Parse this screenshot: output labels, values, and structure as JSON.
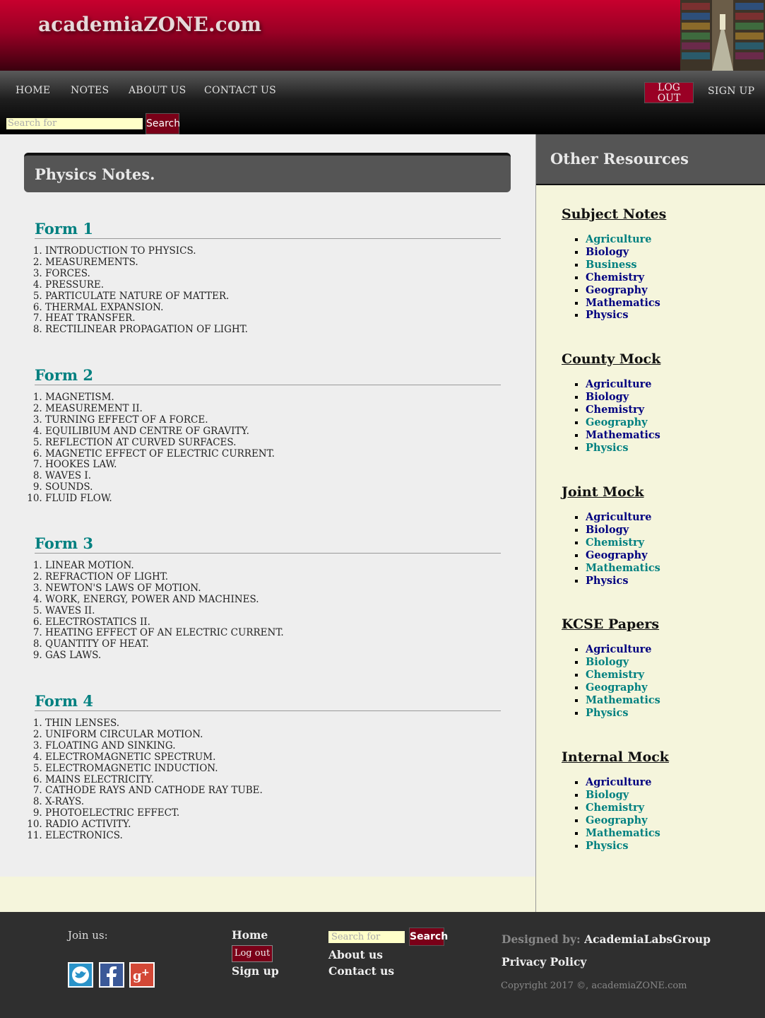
{
  "site": {
    "logo": "academiaZONE.com"
  },
  "nav": {
    "items": [
      "HOME",
      "NOTES",
      "ABOUT US",
      "CONTACT US"
    ],
    "logout": "LOG OUT",
    "signup": "SIGN UP",
    "search_placeholder": "Search for",
    "search_button": "Search"
  },
  "main": {
    "title": "Physics Notes.",
    "forms": [
      {
        "heading": "Form 1",
        "topics": [
          "INTRODUCTION TO PHYSICS.",
          "MEASUREMENTS.",
          "FORCES.",
          "PRESSURE.",
          "PARTICULATE NATURE OF MATTER.",
          "THERMAL EXPANSION.",
          "HEAT TRANSFER.",
          "RECTILINEAR PROPAGATION OF LIGHT."
        ]
      },
      {
        "heading": "Form 2",
        "topics": [
          "MAGNETISM.",
          "MEASUREMENT II.",
          "TURNING EFFECT OF A FORCE.",
          "EQUILIBIUM AND CENTRE OF GRAVITY.",
          "REFLECTION AT CURVED SURFACES.",
          "MAGNETIC EFFECT OF ELECTRIC CURRENT.",
          "HOOKES LAW.",
          "WAVES I.",
          "SOUNDS.",
          "FLUID FLOW."
        ]
      },
      {
        "heading": "Form 3",
        "topics": [
          "LINEAR MOTION.",
          "REFRACTION OF LIGHT.",
          "NEWTON'S LAWS OF MOTION.",
          "WORK, ENERGY, POWER AND MACHINES.",
          "WAVES II.",
          "ELECTROSTATICS II.",
          "HEATING EFFECT OF AN ELECTRIC CURRENT.",
          "QUANTITY OF HEAT.",
          "GAS LAWS."
        ]
      },
      {
        "heading": "Form 4",
        "topics": [
          "THIN LENSES.",
          "UNIFORM CIRCULAR MOTION.",
          "FLOATING AND SINKING.",
          "ELECTROMAGNETIC SPECTRUM.",
          "ELECTROMAGNETIC INDUCTION.",
          "MAINS ELECTRICITY.",
          "CATHODE RAYS AND CATHODE RAY TUBE.",
          "X-RAYS.",
          "PHOTOELECTRIC EFFECT.",
          "RADIO ACTIVITY.",
          "ELECTRONICS."
        ]
      }
    ]
  },
  "sidebar": {
    "title": "Other Resources",
    "groups": [
      {
        "title": "Subject Notes",
        "items": [
          {
            "label": "Agriculture",
            "color": "teal"
          },
          {
            "label": "Biology",
            "color": "navy"
          },
          {
            "label": "Business",
            "color": "teal"
          },
          {
            "label": "Chemistry",
            "color": "navy"
          },
          {
            "label": "Geography",
            "color": "navy"
          },
          {
            "label": "Mathematics",
            "color": "navy"
          },
          {
            "label": "Physics",
            "color": "navy"
          }
        ]
      },
      {
        "title": "County Mock",
        "items": [
          {
            "label": "Agriculture",
            "color": "navy"
          },
          {
            "label": "Biology",
            "color": "navy"
          },
          {
            "label": "Chemistry",
            "color": "navy"
          },
          {
            "label": "Geography",
            "color": "teal"
          },
          {
            "label": "Mathematics",
            "color": "navy"
          },
          {
            "label": "Physics",
            "color": "teal"
          }
        ]
      },
      {
        "title": "Joint Mock",
        "items": [
          {
            "label": "Agriculture",
            "color": "navy"
          },
          {
            "label": "Biology",
            "color": "navy"
          },
          {
            "label": "Chemistry",
            "color": "teal"
          },
          {
            "label": "Geography",
            "color": "navy"
          },
          {
            "label": "Mathematics",
            "color": "teal"
          },
          {
            "label": "Physics",
            "color": "navy"
          }
        ]
      },
      {
        "title": "KCSE Papers",
        "items": [
          {
            "label": "Agriculture",
            "color": "navy"
          },
          {
            "label": "Biology",
            "color": "teal"
          },
          {
            "label": "Chemistry",
            "color": "teal"
          },
          {
            "label": "Geography",
            "color": "teal"
          },
          {
            "label": "Mathematics",
            "color": "teal"
          },
          {
            "label": "Physics",
            "color": "teal"
          }
        ]
      },
      {
        "title": "Internal Mock",
        "items": [
          {
            "label": "Agriculture",
            "color": "navy"
          },
          {
            "label": "Biology",
            "color": "teal"
          },
          {
            "label": "Chemistry",
            "color": "teal"
          },
          {
            "label": "Geography",
            "color": "teal"
          },
          {
            "label": "Mathematics",
            "color": "teal"
          },
          {
            "label": "Physics",
            "color": "teal"
          }
        ]
      }
    ]
  },
  "footer": {
    "join": "Join us:",
    "social": [
      "twitter-icon",
      "facebook-icon",
      "google-plus-icon"
    ],
    "home": "Home",
    "logout": "Log out",
    "signup": "Sign up",
    "search_placeholder": "Search for",
    "search_button": "Search",
    "about": "About us",
    "contact": "Contact us",
    "designed_label": "Designed by:",
    "designed_value": "AcademiaLabsGroup",
    "privacy": "Privacy Policy",
    "copyright": "Copyright 2017 ©, academiaZONE.com"
  },
  "colors": {
    "accent": "#9a0025",
    "teal": "#008080",
    "navy": "#000080",
    "topic": "#8b0000"
  }
}
